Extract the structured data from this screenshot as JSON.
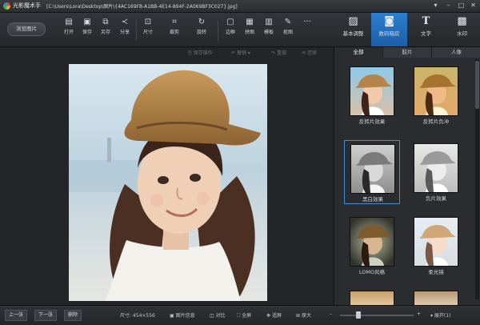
{
  "window": {
    "app_name": "光影魔术手",
    "file_path": "[C:\\Users\\Lora\\Desktop\\图片\\{4AC169FB-A1BB-4E14-894F-2A069BF3C027}.jpg]",
    "controls": [
      "▾",
      "–",
      "□",
      "✕"
    ]
  },
  "toolbar": {
    "open_label": "浏览图片",
    "tools": [
      {
        "label": "打开",
        "icon": "open-icon",
        "glyph": "▤"
      },
      {
        "label": "保存",
        "icon": "save-icon",
        "glyph": "▣"
      },
      {
        "label": "另存",
        "icon": "save-as-icon",
        "glyph": "⧉"
      },
      {
        "label": "分享",
        "icon": "share-icon",
        "glyph": "≺"
      },
      {
        "label": "尺寸",
        "icon": "resize-icon",
        "glyph": "⊡"
      },
      {
        "label": "裁剪",
        "icon": "crop-icon",
        "glyph": "⌗"
      },
      {
        "label": "旋转",
        "icon": "rotate-icon",
        "glyph": "↻"
      },
      {
        "label": "边框",
        "icon": "frame-icon",
        "glyph": "▢"
      },
      {
        "label": "拼图",
        "icon": "collage-icon",
        "glyph": "▦"
      },
      {
        "label": "模板",
        "icon": "template-icon",
        "glyph": "▥"
      },
      {
        "label": "抠图",
        "icon": "cutout-icon",
        "glyph": "✎"
      },
      {
        "label": "···",
        "icon": "more-icon",
        "glyph": "···"
      }
    ],
    "modes": [
      {
        "label": "基本调整",
        "icon": "adjust-icon",
        "glyph": "▨"
      },
      {
        "label": "数码暗房",
        "icon": "camera-icon",
        "glyph": "◙"
      },
      {
        "label": "文字",
        "icon": "text-icon",
        "glyph": "T"
      },
      {
        "label": "水印",
        "icon": "watermark-icon",
        "glyph": "▩"
      }
    ],
    "active_mode": 1
  },
  "undo_bar": {
    "save_label": "保存操作",
    "undo_label": "撤销",
    "redo_label": "重做",
    "restore_label": "还原"
  },
  "panel": {
    "tabs": [
      "全部",
      "胶片",
      "人像"
    ],
    "active_tab": 0,
    "effects": [
      {
        "label": "反转片效果"
      },
      {
        "label": "反转片负冲"
      },
      {
        "label": "黑白效果"
      },
      {
        "label": "负片效果"
      },
      {
        "label": "LOMO风格"
      },
      {
        "label": "柔光镜"
      }
    ],
    "selected_effect": 2
  },
  "statusbar": {
    "prev_label": "上一张",
    "next_label": "下一张",
    "delete_label": "删除",
    "size_text": "尺寸: 454×556",
    "info_label": "图片信息",
    "compare_label": "对比",
    "fullscreen_label": "全屏",
    "fit_label": "适屏",
    "original_label": "原大",
    "zoom_fraction": 0.25,
    "expand_label": "展开(1)"
  }
}
